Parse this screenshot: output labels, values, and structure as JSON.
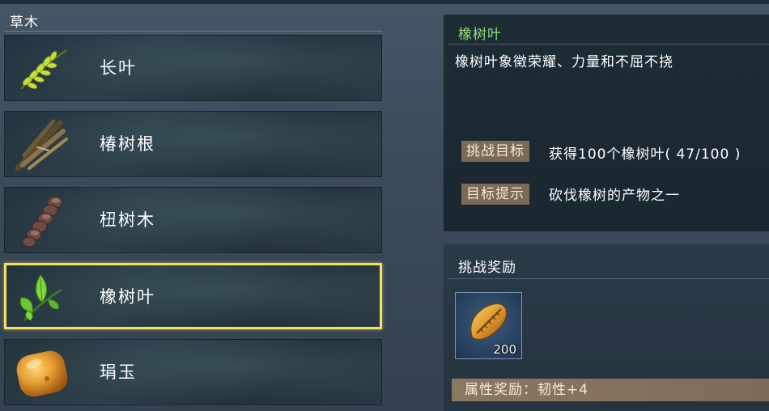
{
  "category": {
    "title": "草木",
    "items": [
      {
        "label": "长叶",
        "icon": "long-leaf-icon"
      },
      {
        "label": "椿树根",
        "icon": "tree-root-icon"
      },
      {
        "label": "杻树木",
        "icon": "wood-log-icon"
      },
      {
        "label": "橡树叶",
        "icon": "oak-leaf-icon",
        "selected": true
      },
      {
        "label": "琄玉",
        "icon": "amber-jade-icon"
      }
    ]
  },
  "detail": {
    "name": "橡树叶",
    "description": "橡树叶象徵荣耀、力量和不屈不挠",
    "challenge_goal_label": "挑战目标",
    "challenge_goal_value": "获得100个橡树叶( 47/100 )",
    "goal_hint_label": "目标提示",
    "goal_hint_value": "砍伐橡树的产物之一",
    "name_color": "#8fe07a"
  },
  "reward": {
    "title": "挑战奖励",
    "item_icon": "golden-seed-icon",
    "item_count": "200",
    "attribute": "属性奖励：韧性+4"
  },
  "colors": {
    "selection_border": "#f1e15b",
    "tag_bg": "#7a6a56"
  }
}
